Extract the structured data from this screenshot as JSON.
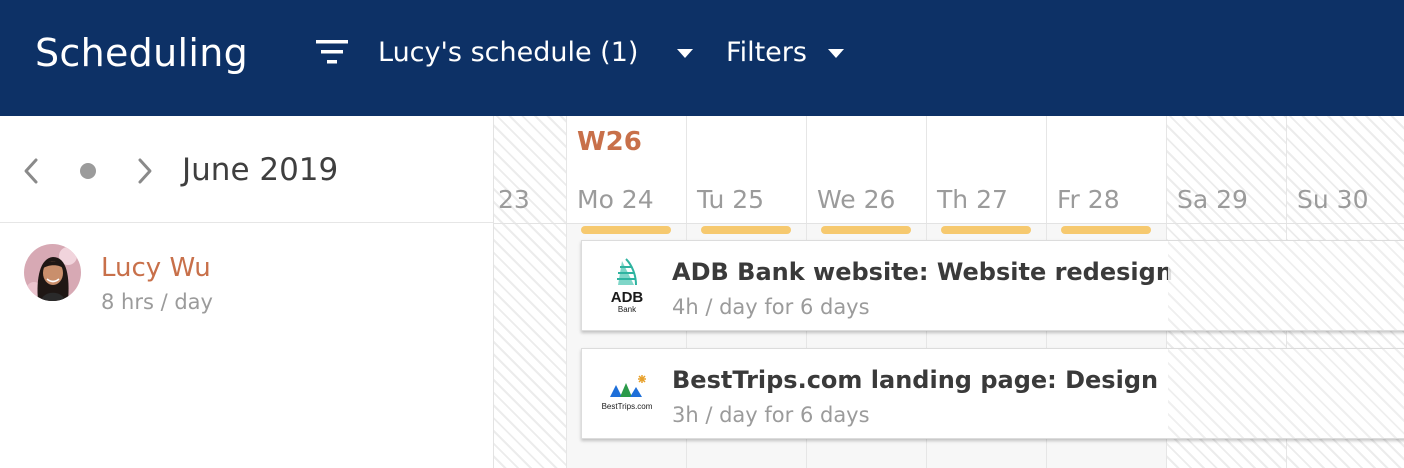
{
  "header": {
    "title": "Scheduling",
    "schedule_selector": "Lucy's schedule (1)",
    "filters_label": "Filters",
    "colors": {
      "background": "#0d3166",
      "text": "#ffffff"
    }
  },
  "navigation": {
    "month": "June 2019",
    "prev_icon": "chevron-left-icon",
    "today_icon": "dot-icon",
    "next_icon": "chevron-right-icon"
  },
  "calendar": {
    "week_label": "W26",
    "days": [
      {
        "label": "23",
        "weekend": true
      },
      {
        "label": "Mo 24",
        "weekend": false
      },
      {
        "label": "Tu 25",
        "weekend": false
      },
      {
        "label": "We 26",
        "weekend": false
      },
      {
        "label": "Th 27",
        "weekend": false
      },
      {
        "label": "Fr 28",
        "weekend": false
      },
      {
        "label": "Sa 29",
        "weekend": true
      },
      {
        "label": "Su 30",
        "weekend": true
      }
    ],
    "accent_color": "#c8704a",
    "capacity_color": "#f6c96f"
  },
  "person": {
    "name": "Lucy Wu",
    "hours": "8 hrs / day"
  },
  "tasks": [
    {
      "title": "ADB Bank website: Website redesign",
      "meta": "4h / day for 6 days",
      "logo_text": "ADB",
      "logo_subtext": "Bank"
    },
    {
      "title": "BestTrips.com landing page: Design",
      "meta": "3h / day for 6 days",
      "logo_text": "BestTrips.com"
    }
  ]
}
